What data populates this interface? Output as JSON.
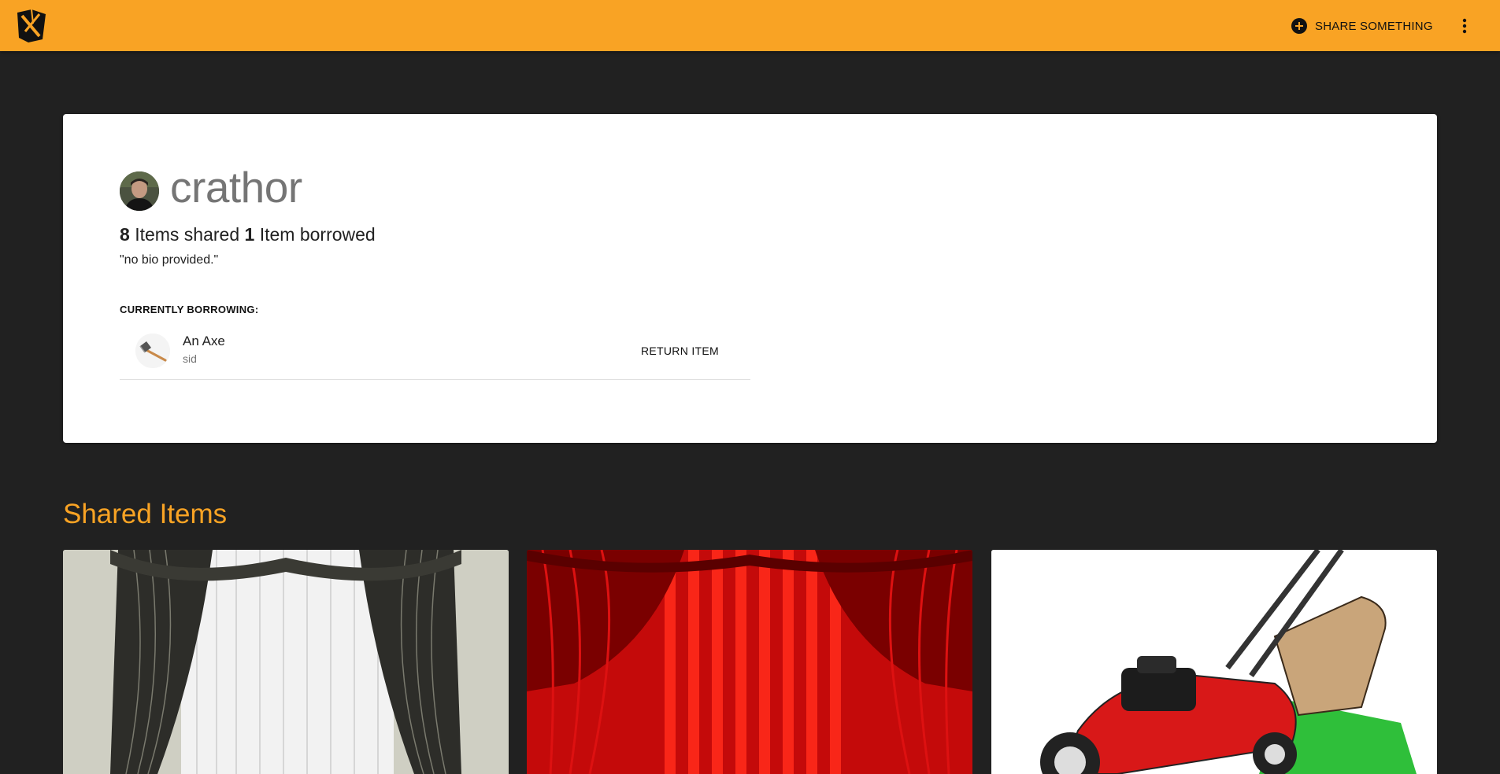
{
  "header": {
    "logo_icon": "boomtown-logo",
    "share_icon": "add-circle-icon",
    "share_label": "SHARE SOMETHING",
    "more_icon": "more-vert-icon",
    "accent_color": "#f9a324"
  },
  "profile": {
    "username": "crathor",
    "avatar_icon": "user-avatar",
    "items_shared_count": "8",
    "items_shared_label": "Items shared",
    "items_borrowed_count": "1",
    "items_borrowed_label": "Item borrowed",
    "bio": "\"no bio provided.\"",
    "borrowing_heading": "CURRENTLY BORROWING:",
    "borrowed_items": [
      {
        "title": "An Axe",
        "owner": "sid",
        "icon": "axe-thumbnail",
        "action_label": "RETURN ITEM"
      }
    ]
  },
  "shared": {
    "title": "Shared Items",
    "items": [
      {
        "image": "curtains-black-white"
      },
      {
        "image": "curtains-red-stage"
      },
      {
        "image": "lawn-mower"
      }
    ]
  }
}
